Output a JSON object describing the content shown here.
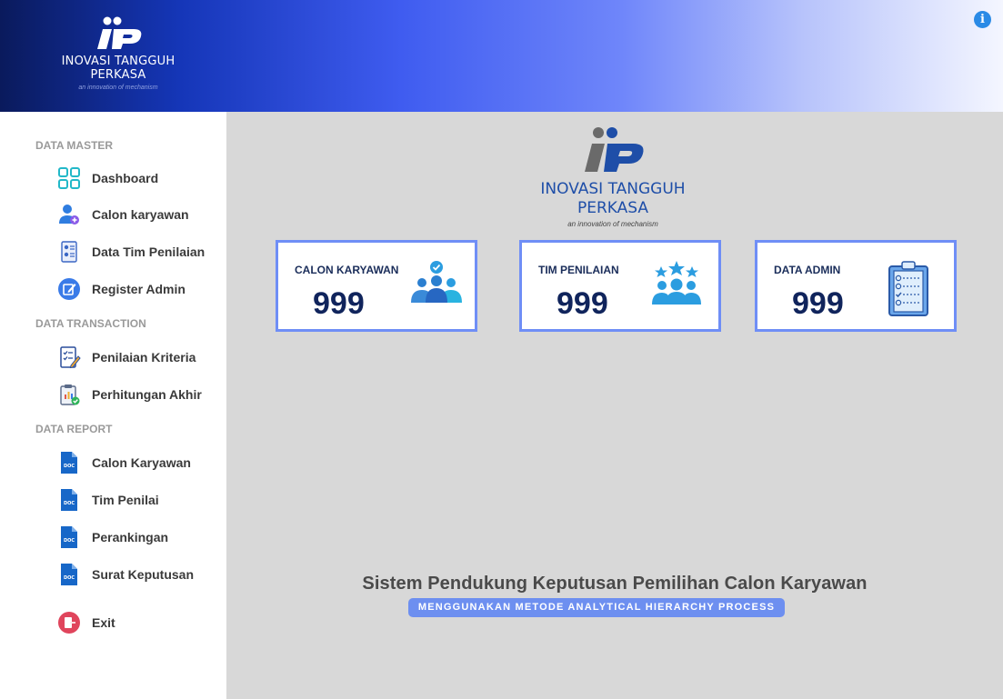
{
  "header": {
    "logo_name": "INOVASI TANGGUH PERKASA",
    "logo_tagline": "an innovation of mechanism"
  },
  "sidebar": {
    "sections": [
      {
        "label": "DATA MASTER",
        "items": [
          {
            "label": "Dashboard",
            "icon": "dashboard-grid-icon"
          },
          {
            "label": "Calon karyawan",
            "icon": "user-add-icon"
          },
          {
            "label": "Data Tim Penilaian",
            "icon": "team-document-icon"
          },
          {
            "label": "Register Admin",
            "icon": "edit-icon"
          }
        ]
      },
      {
        "label": "DATA TRANSACTION",
        "items": [
          {
            "label": "Penilaian Kriteria",
            "icon": "checklist-edit-icon"
          },
          {
            "label": "Perhitungan Akhir",
            "icon": "clipboard-check-icon"
          }
        ]
      },
      {
        "label": "DATA REPORT",
        "items": [
          {
            "label": "Calon Karyawan",
            "icon": "doc-file-icon"
          },
          {
            "label": "Tim Penilai",
            "icon": "doc-file-icon"
          },
          {
            "label": "Perankingan",
            "icon": "doc-file-icon"
          },
          {
            "label": "Surat Keputusan",
            "icon": "doc-file-icon"
          }
        ]
      }
    ],
    "exit_label": "Exit"
  },
  "main": {
    "logo_name": "INOVASI TANGGUH PERKASA",
    "logo_tagline": "an innovation of mechanism",
    "cards": [
      {
        "title": "CALON KARYAWAN",
        "value": "999",
        "icon": "users-check-icon"
      },
      {
        "title": "TIM PENILAIAN",
        "value": "999",
        "icon": "team-stars-icon"
      },
      {
        "title": "DATA ADMIN",
        "value": "999",
        "icon": "clipboard-list-icon"
      }
    ],
    "footer_title": "Sistem Pendukung Keputusan Pemilihan Calon Karyawan",
    "footer_subtitle": "MENGGUNAKAN METODE ANALYTICAL HIERARCHY PROCESS"
  },
  "colors": {
    "accent": "#6f8ef6",
    "brand_blue": "#1e4ea8",
    "value_navy": "#10245c",
    "sidebar_bg": "#ffffff",
    "main_bg": "#d8d8d8"
  }
}
